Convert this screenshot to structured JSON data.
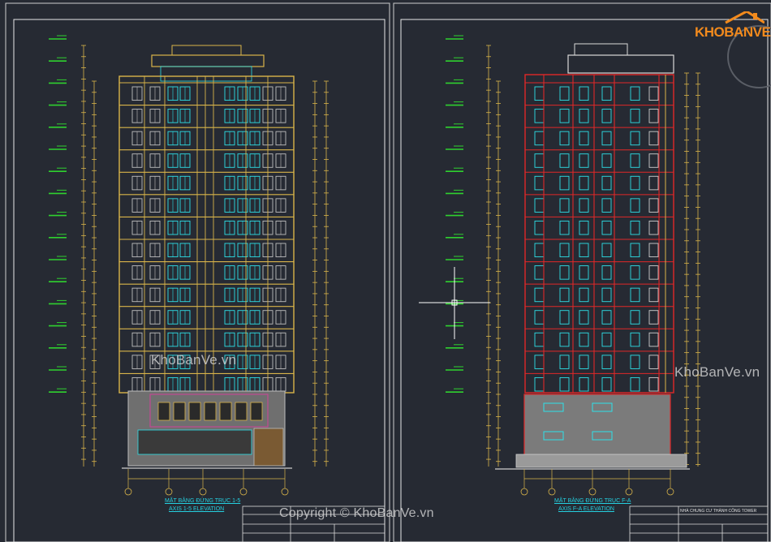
{
  "drawing": {
    "left_caption_line1": "MẶT BẰNG ĐỨNG TRỤC 1-5",
    "left_caption_line2": "AXIS 1-5 ELEVATION",
    "right_caption_line1": "MẶT BẰNG ĐỨNG TRỤC F-A",
    "right_caption_line2": "AXIS F-A ELEVATION",
    "right_titleblock_text": "NHÀ CHUNG CƯ THÀNH CÔNG TOWER"
  },
  "watermark": {
    "center": "KhoBanVe.vn",
    "copyright": "Copyright © KhoBanVe.vn",
    "logo": "KHOBANVE"
  },
  "colors": {
    "background": "#262a33",
    "frame": "#d8d8d8",
    "dimension": "#d9b44a",
    "level_marker": "#2fd12f",
    "window": "#2ee0e8",
    "structure_red": "#e02828",
    "wall_gray": "#8e8e8e",
    "caption": "#25d0e0",
    "logo_orange": "#f28a1d"
  }
}
